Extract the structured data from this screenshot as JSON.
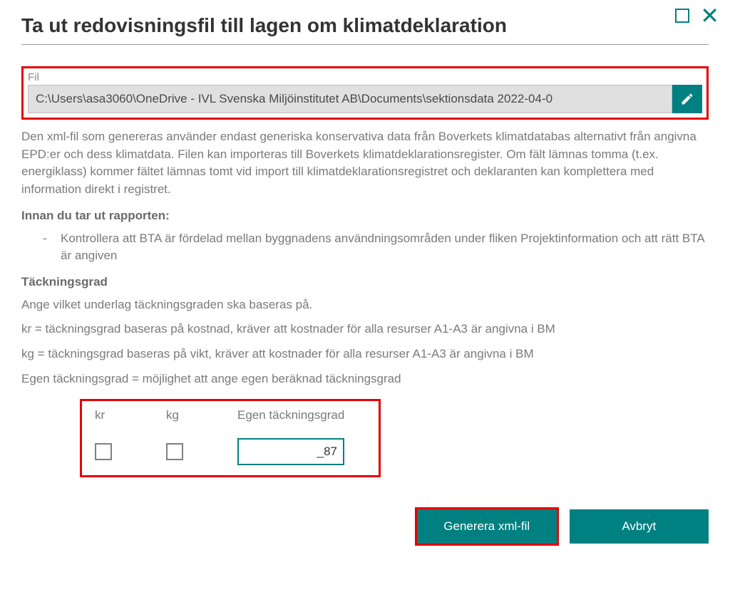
{
  "window": {
    "title": "Ta ut redovisningsfil till lagen om klimatdeklaration"
  },
  "file": {
    "label": "Fil",
    "path": "C:\\Users\\asa3060\\OneDrive - IVL Svenska Miljöinstitutet AB\\Documents\\sektionsdata 2022-04-0"
  },
  "description": "Den xml-fil som genereras använder endast generiska konservativa data från Boverkets klimatdatabas alternativt från angivna EPD:er och dess klimatdata. Filen kan importeras till Boverkets klimatdeklarationsregister. Om fält lämnas tomma (t.ex. energiklass) kommer fältet lämnas tomt vid import till klimatdeklarationsregistret och deklaranten kan komplettera med information direkt i registret.",
  "before_report": {
    "heading": "Innan du tar ut rapporten:",
    "bullet": "Kontrollera att BTA är fördelad mellan byggnadens användningsområden under fliken Projektinformation och att rätt BTA är angiven"
  },
  "coverage": {
    "heading": "Täckningsgrad",
    "intro": "Ange vilket underlag täckningsgraden ska baseras på.",
    "kr_desc": "kr = täckningsgrad baseras på kostnad, kräver att kostnader för alla resurser A1-A3 är angivna i BM",
    "kg_desc": "kg = täckningsgrad baseras på vikt, kräver att kostnader för alla resurser A1-A3 är angivna i BM",
    "egen_desc": "Egen täckningsgrad = möjlighet att ange egen beräknad täckningsgrad",
    "labels": {
      "kr": "kr",
      "kg": "kg",
      "egen": "Egen täckningsgrad"
    },
    "egen_value": "_87"
  },
  "buttons": {
    "generate": "Generera xml-fil",
    "cancel": "Avbryt"
  }
}
